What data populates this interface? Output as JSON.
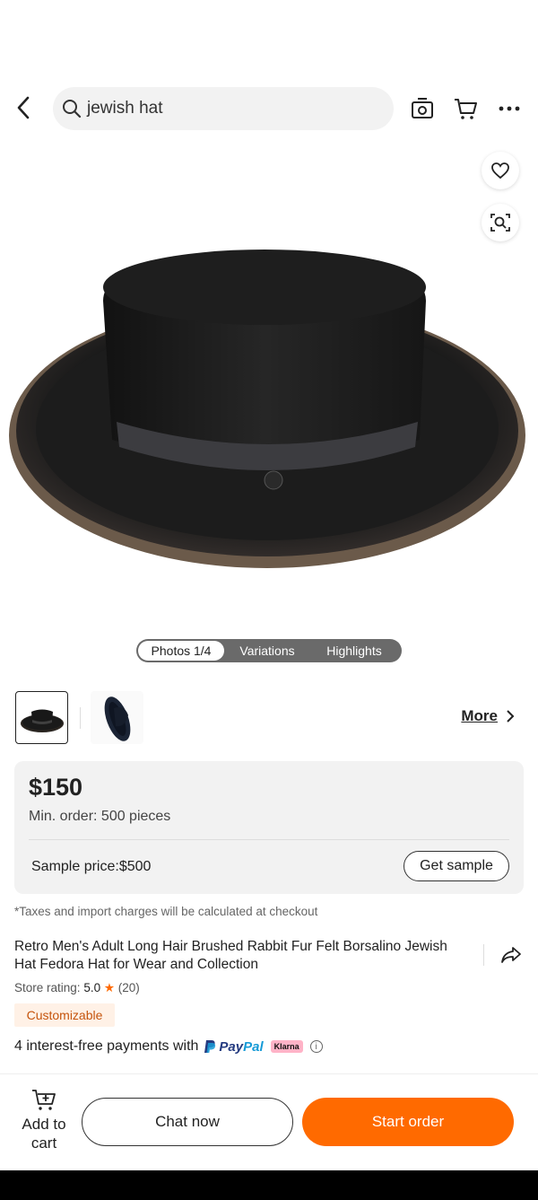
{
  "search": {
    "query": "jewish hat"
  },
  "icons": {
    "back": "back-arrow-icon",
    "search": "search-icon",
    "camera": "camera-icon",
    "cart": "cart-icon",
    "more": "more-dots-icon",
    "favorite": "heart-icon",
    "visual_search": "image-search-icon",
    "share": "share-icon",
    "add_to_cart": "cart-plus-icon"
  },
  "gallery": {
    "tabs": [
      "Photos 1/4",
      "Variations",
      "Highlights"
    ],
    "more_label": "More"
  },
  "pricing": {
    "price": "$150",
    "min_order": "Min. order: 500 pieces",
    "sample_price": "Sample price:$500",
    "get_sample_label": "Get sample"
  },
  "product": {
    "tax_note": "*Taxes and import charges will be calculated at checkout",
    "title": "Retro Men's Adult Long Hair Brushed Rabbit Fur Felt Borsalino Jewish Hat Fedora Hat for Wear and Collection",
    "rating_label": "Store rating:",
    "rating_value": "5.0",
    "rating_star": "★",
    "rating_count": "(20)",
    "badge": "Customizable",
    "payments_text": "4 interest-free payments with",
    "paypal_pay": "Pay",
    "paypal_pal": "Pal",
    "klarna": "Klarna",
    "info_glyph": "i"
  },
  "actions": {
    "add_to_cart": "Add to cart",
    "chat_now": "Chat now",
    "start_order": "Start order"
  },
  "colors": {
    "accent": "#ff6a00",
    "badge_bg": "#fff1e6",
    "badge_text": "#c5540c"
  }
}
